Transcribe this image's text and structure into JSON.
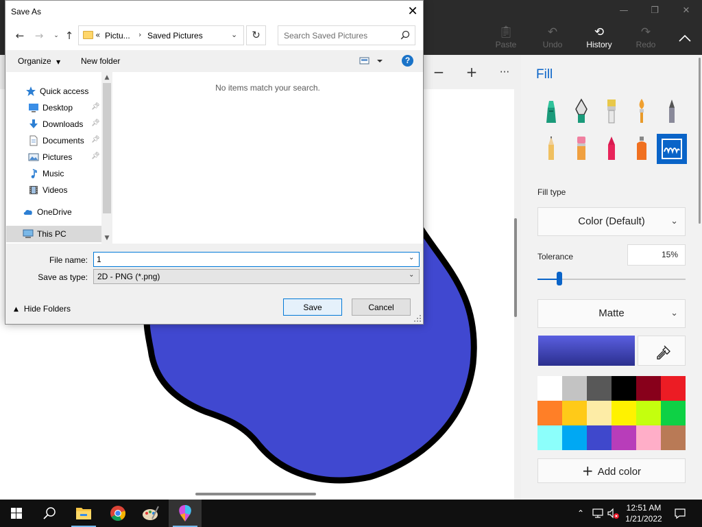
{
  "app": {
    "toolbar": {
      "paste_label": "Paste",
      "undo_label": "Undo",
      "history_label": "History",
      "redo_label": "Redo"
    },
    "canvas_toolbar": [
      "−",
      "+",
      "···"
    ],
    "fill_color": "#4048d0",
    "outline_color": "#000000"
  },
  "side_panel": {
    "title": "Fill",
    "brushes": [
      "marker-icon",
      "calligraphy-pen-icon",
      "oil-brush-icon",
      "watercolor-icon",
      "pencil-icon",
      "pixel-pencil-icon",
      "eraser-icon",
      "crayon-icon",
      "spray-can-icon",
      "fill-bucket-icon"
    ],
    "selected_brush": "fill-bucket-icon",
    "fill_type_label": "Fill type",
    "fill_type_value": "Color (Default)",
    "tolerance_label": "Tolerance",
    "tolerance_value": "15%",
    "tolerance_fraction": 0.15,
    "finish_value": "Matte",
    "current_color": "#4048d0",
    "palette": [
      "#ffffff",
      "#c3c3c3",
      "#585858",
      "#000000",
      "#88001b",
      "#ec1c24",
      "#ff7f27",
      "#ffca18",
      "#fdeca6",
      "#fff200",
      "#c4ff0e",
      "#0ed145",
      "#8cfffb",
      "#00a8f3",
      "#3f48cc",
      "#b83dba",
      "#ffaec8",
      "#b97a56"
    ],
    "add_color_label": "Add color",
    "accent_color": "#0a64c8"
  },
  "dialog": {
    "title": "Save As",
    "breadcrumb": [
      "Pictu...",
      "Saved Pictures"
    ],
    "search_placeholder": "Search Saved Pictures",
    "organize_label": "Organize",
    "new_folder_label": "New folder",
    "nav_items": [
      {
        "label": "Quick access",
        "icon": "star-icon",
        "pinned": false
      },
      {
        "label": "Desktop",
        "icon": "desktop-icon",
        "pinned": true
      },
      {
        "label": "Downloads",
        "icon": "download-arrow-icon",
        "pinned": true
      },
      {
        "label": "Documents",
        "icon": "document-icon",
        "pinned": true
      },
      {
        "label": "Pictures",
        "icon": "pictures-icon",
        "pinned": true
      },
      {
        "label": "Music",
        "icon": "music-note-icon",
        "pinned": false
      },
      {
        "label": "Videos",
        "icon": "film-icon",
        "pinned": false
      },
      {
        "label": "OneDrive",
        "icon": "cloud-icon",
        "pinned": false
      },
      {
        "label": "This PC",
        "icon": "computer-icon",
        "pinned": false,
        "selected": true
      }
    ],
    "empty_message": "No items match your search.",
    "file_name_label": "File name:",
    "file_name_value": "1",
    "save_type_label": "Save as type:",
    "save_type_value": "2D - PNG (*.png)",
    "hide_folders_label": "Hide Folders",
    "save_label": "Save",
    "cancel_label": "Cancel"
  },
  "taskbar": {
    "apps": [
      "start-icon",
      "search-icon",
      "file-explorer-icon",
      "chrome-icon",
      "paint-icon",
      "paint-3d-icon"
    ],
    "time": "12:51 AM",
    "date": "1/21/2022"
  }
}
